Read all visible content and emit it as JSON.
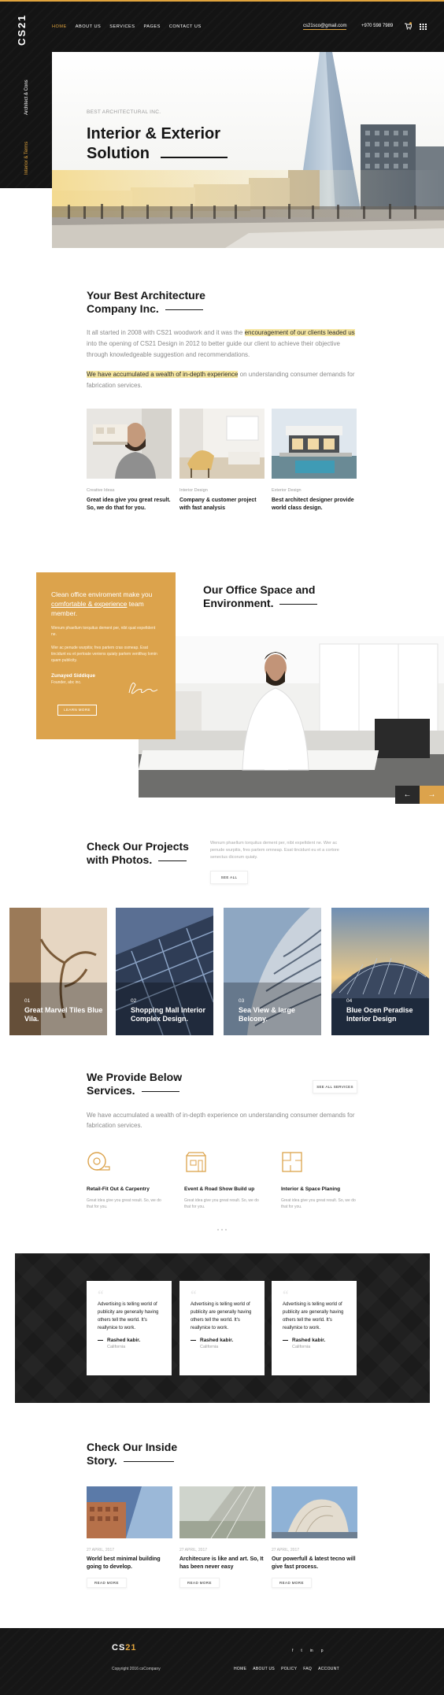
{
  "colors": {
    "accent": "#e0a43d",
    "dark": "#141414",
    "box": "#dca34c"
  },
  "header": {
    "logo": "CS21",
    "nav": [
      "HOME",
      "ABOUT US",
      "SERVICES",
      "PAGES",
      "CONTACT US"
    ],
    "email": "cs21sco@gmail.com",
    "phone": "+970 598 7989",
    "icons": [
      "cart-icon",
      "grid-menu-icon"
    ]
  },
  "side": {
    "item1": "Architect & Cons",
    "item2": "Interior & Terms"
  },
  "hero": {
    "kicker": "BEST ARCHITECTURAL INC.",
    "title_line1": "Interior & Exterior",
    "title_line2": "Solution"
  },
  "about": {
    "title_line1": "Your Best Architecture",
    "title_line2": "Company Inc.",
    "p1_a": "It all started in 2008 with CS21 woodwork and it was the ",
    "p1_hl": "encouragement of our clients leaded us",
    "p1_b": " into the opening of CS21 Design in 2012 to better guide our client to achieve their objective through knowledgeable suggestion and recommendations.",
    "p2_hl": "We have accumulated a wealth of in-depth experience",
    "p2_b": " on understanding consumer demands for fabrication services.",
    "cards": [
      {
        "tag": "Creative Ideas",
        "text": "Great idea give you great result. So, we do that for you."
      },
      {
        "tag": "Interior Design",
        "text": "Company & customer project with fast analysis"
      },
      {
        "tag": "Exterior Design",
        "text": "Best architect designer provide world class design."
      }
    ]
  },
  "office": {
    "title_line1": "Our Office Space and",
    "title_line2": "Environment.",
    "box_text_a": "Clean office enviroment make you ",
    "box_text_u": "comfortable & experience",
    "box_text_b": " team member.",
    "box_p1": "Wenum phaellum torquitus dement per, nibt quat expeltdent ne.",
    "box_p2": "Wer ac penude wurpitis; fres partem cras osmeap. Esat tincidunt eu et pertoate veniens quiaty partem ventthay lomin quam publicity.",
    "name": "Zunayed Siddique",
    "role": "Founder, abc inc.",
    "button": "LEARN MORE",
    "prev": "←",
    "next": "→"
  },
  "projects": {
    "title_line1": "Check Our Projects",
    "title_line2": "with Photos.",
    "desc": "Wenum phaellum torquitus dement per, nibt expeltdent ne. Wer ac penude wurpitis, fres partem omneap. Esat tincidunt eu et a cortore senectus dicorum quiaty.",
    "button": "SEE ALL",
    "items": [
      {
        "num": "01",
        "title": "Great Marvel Tiles Blue Vila."
      },
      {
        "num": "02",
        "title": "Shopping Mall Interior Complex Design."
      },
      {
        "num": "03",
        "title": "Sea View & large Belcony."
      },
      {
        "num": "04",
        "title": "Blue Ocen Peradise Interior Design"
      }
    ]
  },
  "services": {
    "title_line1": "We Provide Below",
    "title_line2": "Services.",
    "button": "SEE ALL SERVICES",
    "desc": "We have accumulated a wealth of in-depth experience on understanding consumer demands for fabrication services.",
    "items": [
      {
        "icon": "tape-measure-icon",
        "title": "Retail-Fit Out & Carpentry",
        "text": "Great idea give you great result. So, we do that for you."
      },
      {
        "icon": "storefront-icon",
        "title": "Event & Road Show Build up",
        "text": "Great idea give you great result. So, we do that for you."
      },
      {
        "icon": "floor-plan-icon",
        "title": "Interior & Space Planing",
        "text": "Great idea give you great result. So, we do that for you."
      }
    ]
  },
  "testimonials": [
    {
      "quote": "Advertising is telling world of publicity are generally having others tell the world. It's reallynice to work.",
      "name": "Rashed kabir.",
      "location": "California"
    },
    {
      "quote": "Advertising is telling world of publicity are generally having others tell the world. It's reallynice to work.",
      "name": "Rashed kabir.",
      "location": "California"
    },
    {
      "quote": "Advertising is telling world of publicity are generally having others tell the world. It's reallynice to work.",
      "name": "Rashed kabir.",
      "location": "California"
    }
  ],
  "blog": {
    "title_line1": "Check Our Inside",
    "title_line2": "Story.",
    "posts": [
      {
        "date": "27 APRIL, 2017",
        "title": "World best minimal building going to develop.",
        "button": "READ MORE"
      },
      {
        "date": "27 APRIL, 2017",
        "title": "Architecure is like and art. So, It has been never easy",
        "button": "READ MORE"
      },
      {
        "date": "27 APRIL, 2017",
        "title": "Our powerfull & latest tecno will give fast process.",
        "button": "READ MORE"
      }
    ]
  },
  "footer": {
    "logo_a": "CS",
    "logo_b": "21",
    "copyright": "Copyright 2016 csCompany",
    "social": [
      "f",
      "t",
      "in",
      "p"
    ],
    "nav": [
      "HOME",
      "ABOUT US",
      "POLICY",
      "FAQ",
      "ACCOUNT"
    ]
  }
}
